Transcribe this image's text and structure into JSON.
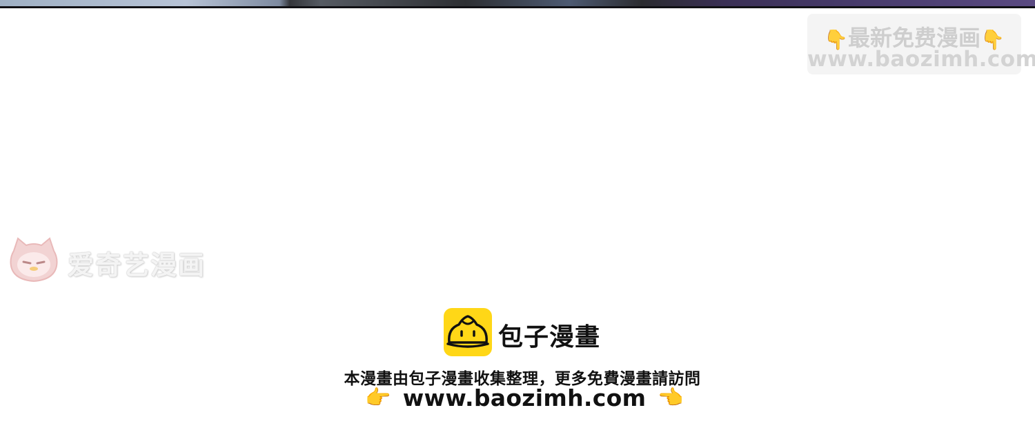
{
  "top_watermark": {
    "line1": "最新免费漫画",
    "line2": "www.baozimh.com",
    "left_icon": "finger-down-icon",
    "right_icon": "finger-down-icon"
  },
  "side_watermark": {
    "text": "爱奇艺漫画",
    "logo_icon": "iqiyi-cat-logo-icon"
  },
  "footer": {
    "brand_name": "包子漫畫",
    "brand_icon": "baozi-bun-icon",
    "notice": "本漫畫由包子漫畫收集整理，更多免費漫畫請訪問",
    "url": "www.baozimh.com",
    "left_hand_icon": "hand-point-right-icon",
    "right_hand_icon": "hand-point-left-icon"
  },
  "colors": {
    "brand_yellow": "#ffd717",
    "text_dark": "#111111",
    "watermark_gray": "#c9c9c9",
    "finger_yellow": "#f5b82b",
    "iqiyi_pink": "#f1c9c9"
  }
}
